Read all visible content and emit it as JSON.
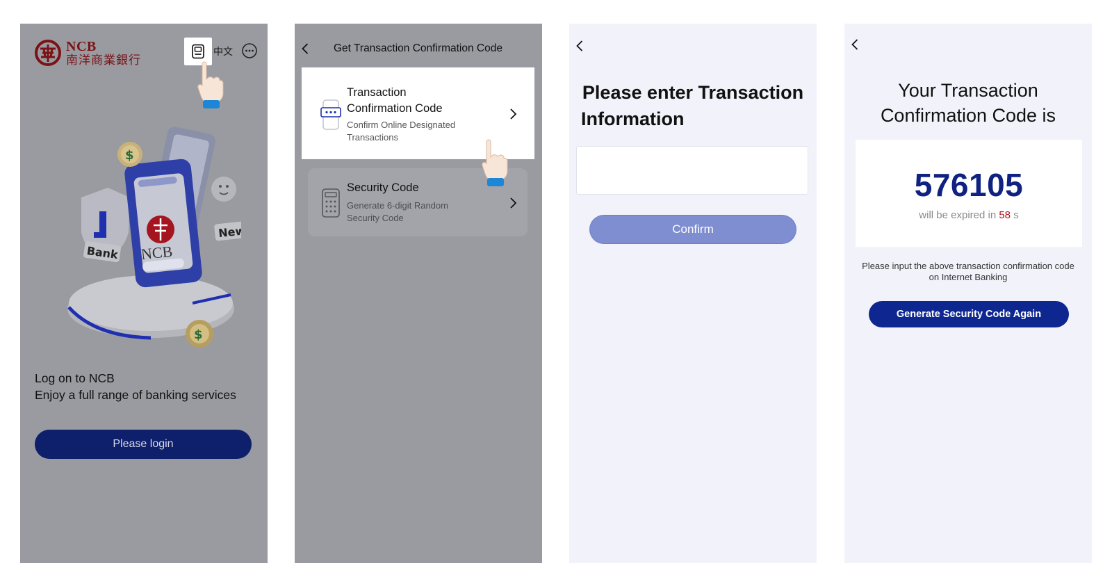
{
  "screen1": {
    "logo": {
      "en": "NCB",
      "zh": "南洋商業銀行",
      "icon": "ncb-logo-icon"
    },
    "qr_icon": "qr-scan-icon",
    "language": "中文",
    "more_icon": "more-icon",
    "hero_badges": {
      "bank": "Bank",
      "new": "New",
      "center": "NCB"
    },
    "welcome_line1": "Log on to NCB",
    "welcome_line2": "Enjoy a full range of banking services",
    "login_label": "Please login"
  },
  "screen2": {
    "title": "Get Transaction Confirmation Code",
    "options": [
      {
        "title_line1": "Transaction",
        "title_line2": "Confirmation Code",
        "sub_line1": "Confirm Online Designated",
        "sub_line2": "Transactions",
        "icon": "phone-password-icon"
      },
      {
        "title_line1": "Security Code",
        "sub_line1": "Generate 6-digit Random",
        "sub_line2": "Security Code",
        "icon": "calculator-icon"
      }
    ]
  },
  "screen3": {
    "heading_line1": "Please enter Transaction",
    "heading_line2": "Information",
    "input_value": "",
    "confirm_label": "Confirm"
  },
  "screen4": {
    "heading_line1": "Your Transaction",
    "heading_line2": "Confirmation Code is",
    "code": "576105",
    "expire_prefix": "will be expired in",
    "expire_seconds": "58",
    "expire_suffix": "s",
    "instruction_line1": "Please input the above transaction confirmation code",
    "instruction_line2": "on Internet Banking",
    "generate_label": "Generate Security Code Again"
  },
  "colors": {
    "dim_overlay": "#9a9ba0",
    "light_bg": "#f2f3fa",
    "brand_navy": "#0e1f6b",
    "code_blue": "#0f2282",
    "logo_red": "#7a1216",
    "countdown_red": "#b0141a"
  }
}
